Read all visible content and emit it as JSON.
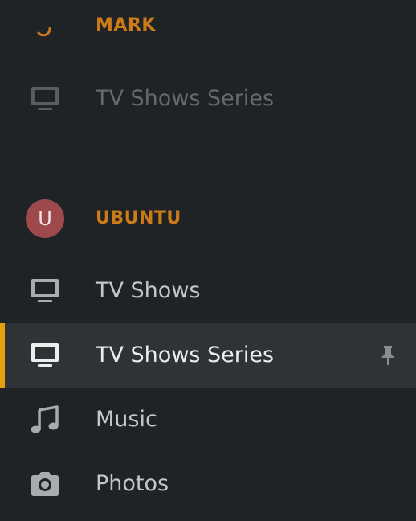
{
  "servers": [
    {
      "name": "MARK",
      "icon": "loading-spinner-icon",
      "items": [
        {
          "label": "TV Shows Series",
          "icon": "tv-monitor-icon",
          "state": "unavailable"
        }
      ]
    },
    {
      "name": "UBUNTU",
      "avatar_letter": "U",
      "avatar_color": "#9e4a4d",
      "items": [
        {
          "label": "TV Shows",
          "icon": "tv-monitor-icon"
        },
        {
          "label": "TV Shows Series",
          "icon": "tv-monitor-icon",
          "state": "selected",
          "pinned": true
        },
        {
          "label": "Music",
          "icon": "music-note-icon"
        },
        {
          "label": "Photos",
          "icon": "camera-icon"
        }
      ]
    }
  ],
  "colors": {
    "background": "#1f2326",
    "server_name": "#cc7b19",
    "selected_indicator": "#e5a00d",
    "selected_background": "#2f3336"
  }
}
